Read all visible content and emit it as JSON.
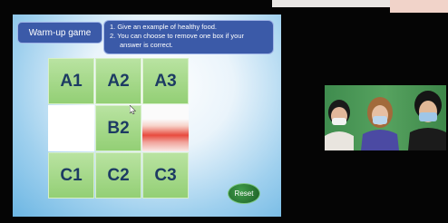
{
  "slide": {
    "title": "Warm-up game",
    "instructions": [
      "1.  Give an example of healthy food.",
      "2.  You can choose to remove one box if your",
      "answer is correct."
    ],
    "tiles": [
      "A1",
      "A2",
      "A3",
      "B2",
      "C1",
      "C2",
      "C3"
    ],
    "reset_label": "Reset"
  },
  "video": {
    "participants": [
      "participant-1",
      "participant-2",
      "participant-3"
    ]
  },
  "colors": {
    "tile": "#a6d98a",
    "tile_text": "#1d3b63",
    "header_box": "#3b5aa8",
    "reset": "#2b7a35",
    "video_bg": "#4a9655"
  }
}
